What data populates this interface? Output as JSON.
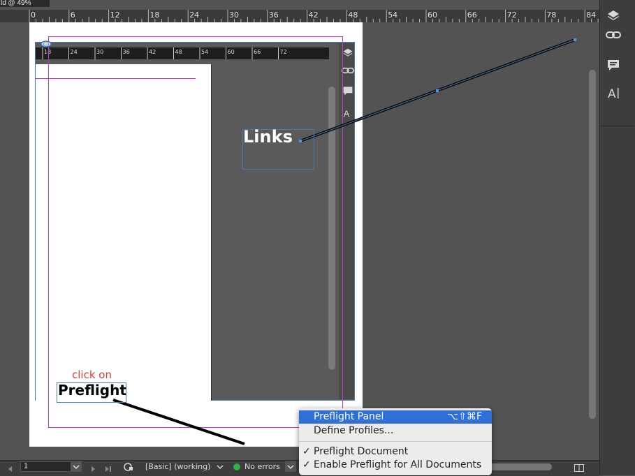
{
  "window": {
    "tab_title": "ld @ 49%"
  },
  "ruler": {
    "ticks": [
      "0",
      "6",
      "12",
      "18",
      "24",
      "30",
      "36",
      "42",
      "48",
      "54",
      "60",
      "66",
      "72",
      "78",
      "84"
    ]
  },
  "inner_ruler": {
    "ticks": [
      "18",
      "24",
      "30",
      "36",
      "42",
      "48",
      "54",
      "60",
      "66",
      "72"
    ]
  },
  "canvas": {
    "links_label": "Links",
    "click_on_label": "click on",
    "preflight_label": "Preflight"
  },
  "statusbar": {
    "page_number": "1",
    "profile": "[Basic] (working)",
    "status": "No errors",
    "status_color": "#2fb344"
  },
  "menu": {
    "items": [
      {
        "label": "Preflight Panel",
        "shortcut": "⌥⇧⌘F",
        "checked": false,
        "highlighted": true
      },
      {
        "label": "Define Profiles...",
        "shortcut": "",
        "checked": false,
        "highlighted": false
      },
      {
        "label": "Preflight Document",
        "shortcut": "",
        "checked": true,
        "highlighted": false
      },
      {
        "label": "Enable Preflight for All Documents",
        "shortcut": "",
        "checked": true,
        "highlighted": false
      }
    ],
    "check_mark": "✓",
    "highlight_color": "#2f6fd8"
  },
  "panels": [
    "layers-icon",
    "links-icon",
    "comments-icon",
    "character-styles-icon"
  ]
}
